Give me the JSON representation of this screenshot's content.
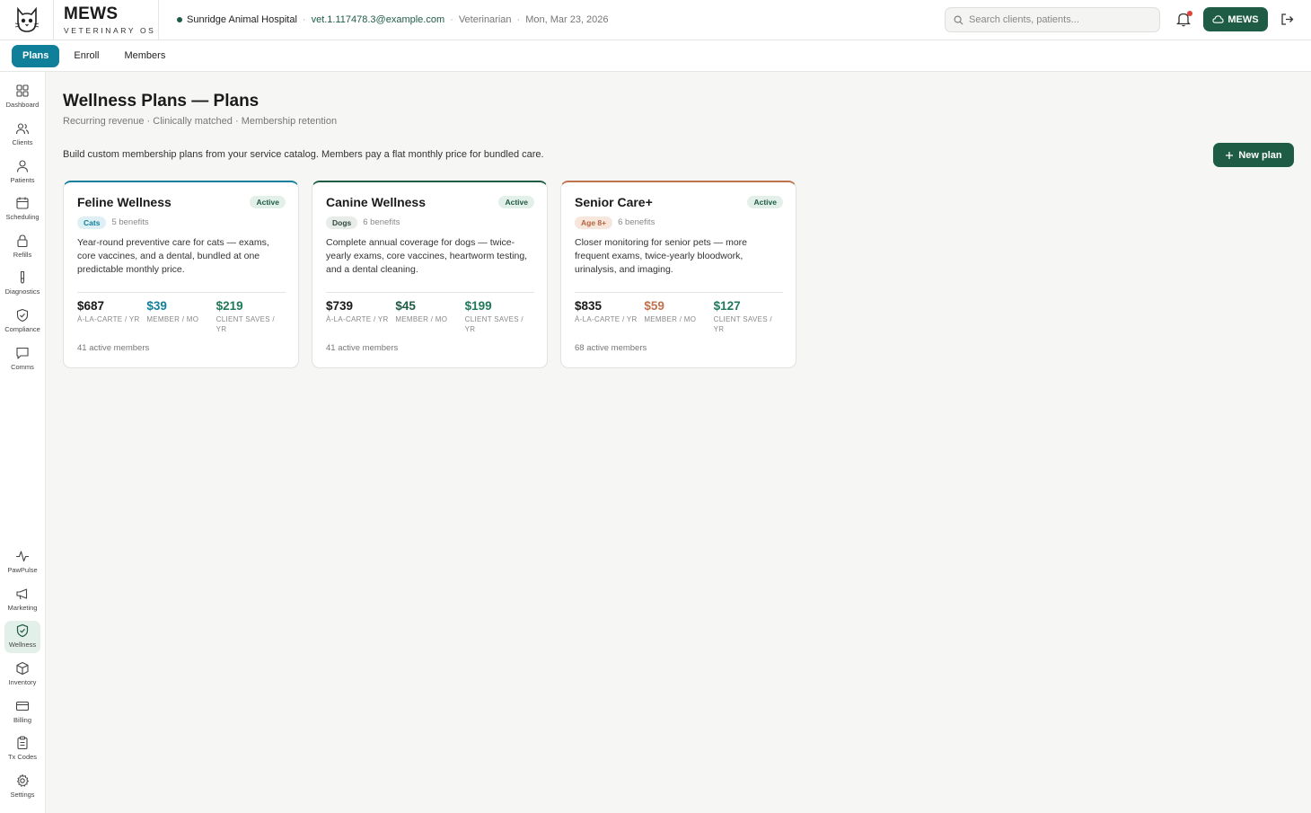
{
  "app": {
    "brand_name": "MEWS",
    "brand_sub": "VETERINARY OS",
    "hospital": "Sunridge Animal Hospital",
    "email": "vet.1.117478.3@example.com",
    "role": "Veterinarian",
    "date": "Mon, Mar 23, 2026",
    "search_placeholder": "Search clients, patients...",
    "mews_button": "MEWS"
  },
  "tabs": [
    {
      "label": "Plans",
      "active": true
    },
    {
      "label": "Enroll",
      "active": false
    },
    {
      "label": "Members",
      "active": false
    }
  ],
  "sidebar": {
    "items": [
      {
        "label": "Dashboard",
        "icon": "grid-icon"
      },
      {
        "label": "Clients",
        "icon": "users-icon"
      },
      {
        "label": "Patients",
        "icon": "user-icon"
      },
      {
        "label": "Scheduling",
        "icon": "calendar-icon"
      },
      {
        "label": "Refills",
        "icon": "lock-icon"
      },
      {
        "label": "Diagnostics",
        "icon": "flask-icon"
      },
      {
        "label": "Compliance",
        "icon": "shield-check-icon"
      },
      {
        "label": "Comms",
        "icon": "chat-icon"
      },
      {
        "label": "PawPulse",
        "icon": "pulse-icon"
      },
      {
        "label": "Marketing",
        "icon": "megaphone-icon"
      },
      {
        "label": "Wellness",
        "icon": "shield-check-icon",
        "active": true
      },
      {
        "label": "Inventory",
        "icon": "box-icon"
      },
      {
        "label": "Billing",
        "icon": "credit-card-icon"
      },
      {
        "label": "Tx Codes",
        "icon": "clipboard-icon"
      },
      {
        "label": "Settings",
        "icon": "gear-icon"
      }
    ]
  },
  "page": {
    "title": "Wellness Plans — Plans",
    "subtitle": "Recurring revenue · Clinically matched · Membership retention",
    "description": "Build custom membership plans from your service catalog. Members pay a flat monthly price for bundled care.",
    "new_plan_label": "New plan"
  },
  "plans": [
    {
      "name": "Feline Wellness",
      "status": "Active",
      "species": "Cats",
      "benefits": "5 benefits",
      "description": "Year-round preventive care for cats — exams, core vaccines, and a dental, bundled at one predictable monthly price.",
      "alacarte": "$687",
      "alacarte_label": "À-LA-CARTE / YR",
      "member": "$39",
      "member_label": "MEMBER / MO",
      "saves": "$219",
      "saves_label": "CLIENT SAVES / YR",
      "active_members": "41 active members",
      "accent": "#0f7f9a"
    },
    {
      "name": "Canine Wellness",
      "status": "Active",
      "species": "Dogs",
      "benefits": "6 benefits",
      "description": "Complete annual coverage for dogs — twice-yearly exams, core vaccines, heartworm testing, and a dental cleaning.",
      "alacarte": "$739",
      "alacarte_label": "À-LA-CARTE / YR",
      "member": "$45",
      "member_label": "MEMBER / MO",
      "saves": "$199",
      "saves_label": "CLIENT SAVES / YR",
      "active_members": "41 active members",
      "accent": "#1f5c46"
    },
    {
      "name": "Senior Care+",
      "status": "Active",
      "species": "Age 8+",
      "benefits": "6 benefits",
      "description": "Closer monitoring for senior pets — more frequent exams, twice-yearly bloodwork, urinalysis, and imaging.",
      "alacarte": "$835",
      "alacarte_label": "À-LA-CARTE / YR",
      "member": "$59",
      "member_label": "MEMBER / MO",
      "saves": "$127",
      "saves_label": "CLIENT SAVES / YR",
      "active_members": "68 active members",
      "accent": "#c0714e"
    }
  ]
}
